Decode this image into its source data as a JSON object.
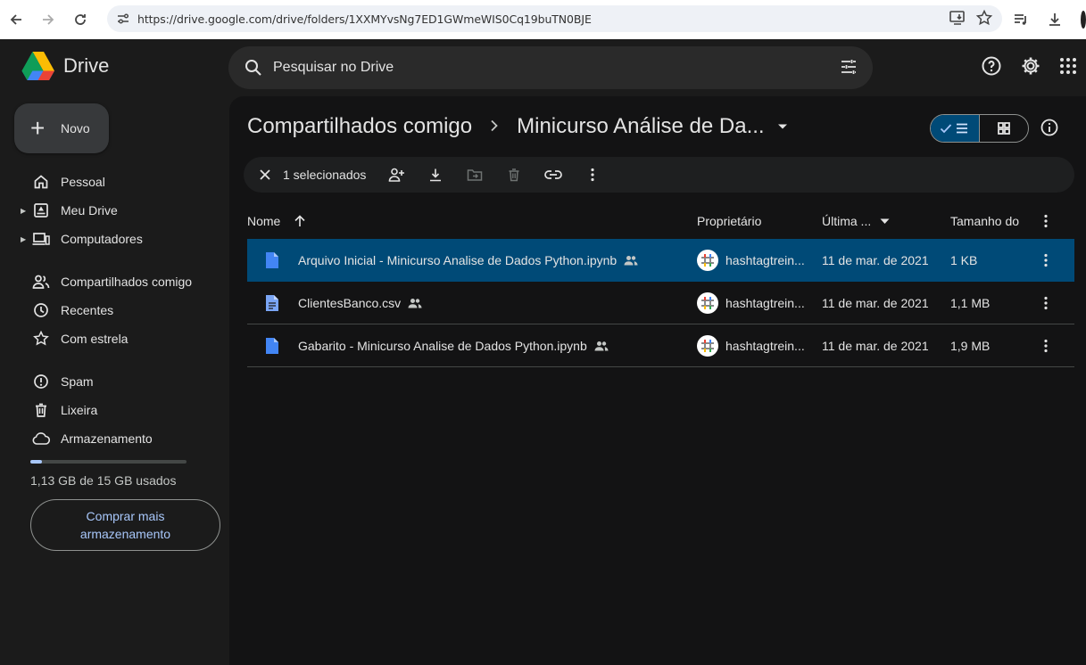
{
  "browser": {
    "url": "https://drive.google.com/drive/folders/1XXMYvsNg7ED1GWmeWIS0Cq19buTN0BJE"
  },
  "header": {
    "app_name": "Drive",
    "search_placeholder": "Pesquisar no Drive"
  },
  "sidebar": {
    "new_label": "Novo",
    "items": [
      {
        "label": "Pessoal",
        "icon": "home-icon"
      },
      {
        "label": "Meu Drive",
        "icon": "my-drive-icon"
      },
      {
        "label": "Computadores",
        "icon": "computer-icon"
      },
      {
        "label": "Compartilhados comigo",
        "icon": "people-icon"
      },
      {
        "label": "Recentes",
        "icon": "clock-icon"
      },
      {
        "label": "Com estrela",
        "icon": "star-icon"
      },
      {
        "label": "Spam",
        "icon": "spam-icon"
      },
      {
        "label": "Lixeira",
        "icon": "trash-icon"
      },
      {
        "label": "Armazenamento",
        "icon": "cloud-icon"
      }
    ],
    "storage_text": "1,13 GB de 15 GB usados",
    "storage_fraction": 0.075,
    "buy_label": "Comprar mais armazenamento"
  },
  "main": {
    "breadcrumb_root": "Compartilhados comigo",
    "breadcrumb_current": "Minicurso Análise de Da...",
    "selection_text": "1 selecionados",
    "columns": {
      "name": "Nome",
      "owner": "Proprietário",
      "modified": "Última ...",
      "size": "Tamanho do"
    },
    "files": [
      {
        "name": "Arquivo Inicial - Minicurso Analise de Dados Python.ipynb",
        "owner": "hashtagtrein...",
        "modified": "11 de mar. de 2021",
        "size": "1 KB",
        "selected": true
      },
      {
        "name": "ClientesBanco.csv",
        "owner": "hashtagtrein...",
        "modified": "11 de mar. de 2021",
        "size": "1,1 MB",
        "selected": false
      },
      {
        "name": "Gabarito - Minicurso Analise de Dados Python.ipynb",
        "owner": "hashtagtrein...",
        "modified": "11 de mar. de 2021",
        "size": "1,9 MB",
        "selected": false
      }
    ]
  },
  "colors": {
    "accent": "#a8c7fa",
    "selected_row": "#004a77",
    "background": "#1b1b1b",
    "panel": "#131314"
  }
}
